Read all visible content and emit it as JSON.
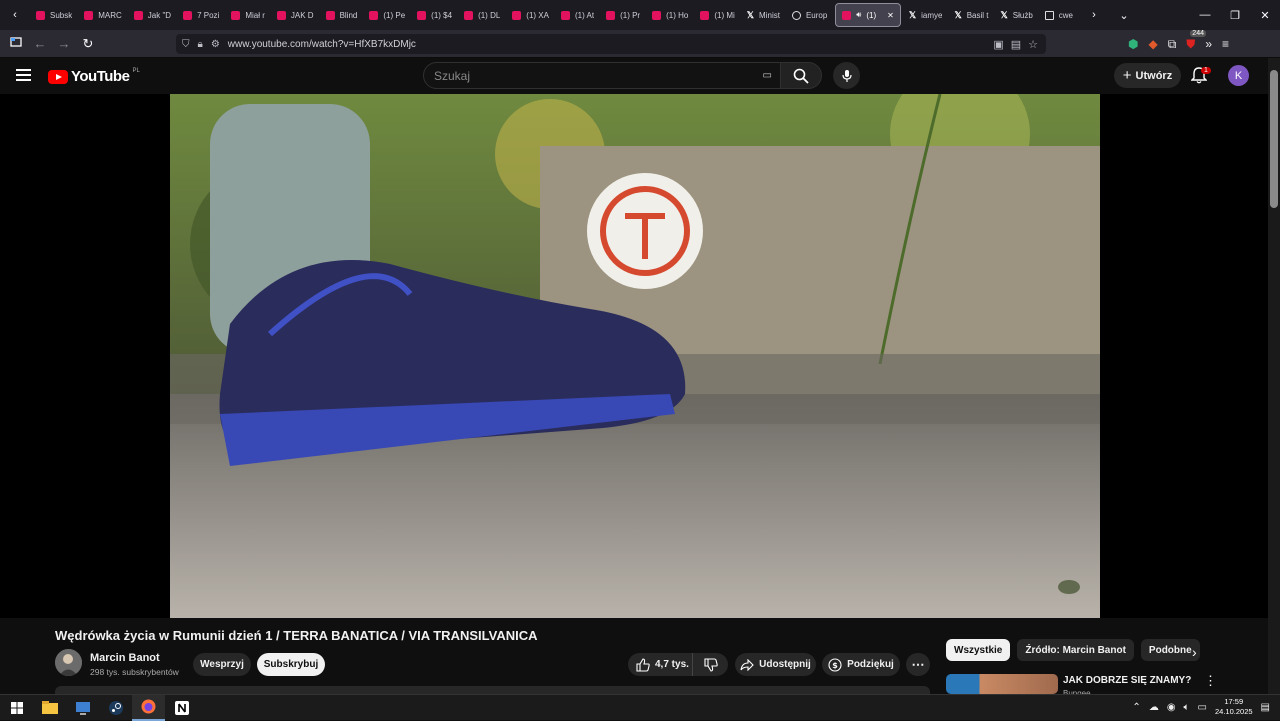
{
  "browser": {
    "tabs": [
      {
        "label": "Subsk",
        "fav": "youtube"
      },
      {
        "label": "MARC",
        "fav": "youtube"
      },
      {
        "label": "Jak \"D",
        "fav": "youtube"
      },
      {
        "label": "7 Pozi",
        "fav": "youtube"
      },
      {
        "label": "Miał r",
        "fav": "youtube"
      },
      {
        "label": "JAK D",
        "fav": "youtube"
      },
      {
        "label": "Blind",
        "fav": "youtube"
      },
      {
        "label": "(1) Pe",
        "fav": "youtube"
      },
      {
        "label": "(1) $4",
        "fav": "youtube"
      },
      {
        "label": "(1) DL",
        "fav": "youtube"
      },
      {
        "label": "(1) XA",
        "fav": "youtube"
      },
      {
        "label": "(1) At",
        "fav": "youtube"
      },
      {
        "label": "(1) Pr",
        "fav": "youtube"
      },
      {
        "label": "(1) Ho",
        "fav": "youtube"
      },
      {
        "label": "(1) Mi",
        "fav": "youtube"
      },
      {
        "label": "Minist",
        "fav": "x"
      },
      {
        "label": "Europ",
        "fav": "globe"
      },
      {
        "label": "(1)",
        "fav": "youtube",
        "active": true
      },
      {
        "label": "iamye",
        "fav": "x"
      },
      {
        "label": "Basil t",
        "fav": "x"
      },
      {
        "label": "Służb",
        "fav": "x"
      },
      {
        "label": "cwe",
        "fav": "grid"
      }
    ],
    "url": "www.youtube.com/watch?v=HfXB7kxDMjc",
    "extension_badge": "244"
  },
  "youtube": {
    "logo_text": "YouTube",
    "country_code": "PL",
    "search_placeholder": "Szukaj",
    "create_label": "Utwórz",
    "notification_count": "1",
    "avatar_letter": "K",
    "avatar_color": "#7e57c2",
    "video": {
      "title": "Wędrówka życia w Rumunii dzień 1 / TERRA BANATICA / VIA TRANSILVANICA",
      "channel": "Marcin Banot",
      "subscribers": "298 tys. subskrybentów",
      "support_label": "Wesprzyj",
      "subscribe_label": "Subskrybuj",
      "likes": "4,7 tys.",
      "share_label": "Udostępnij",
      "thanks_label": "Podziękuj"
    },
    "chips": [
      "Wszystkie",
      "Źródło: Marcin Banot",
      "Podobne"
    ],
    "recommendation": {
      "title": "JAK DOBRZE SIĘ ZNAMY?",
      "channel": "Bungee"
    }
  },
  "taskbar": {
    "time": "17:59",
    "date": "24.10.2025"
  }
}
